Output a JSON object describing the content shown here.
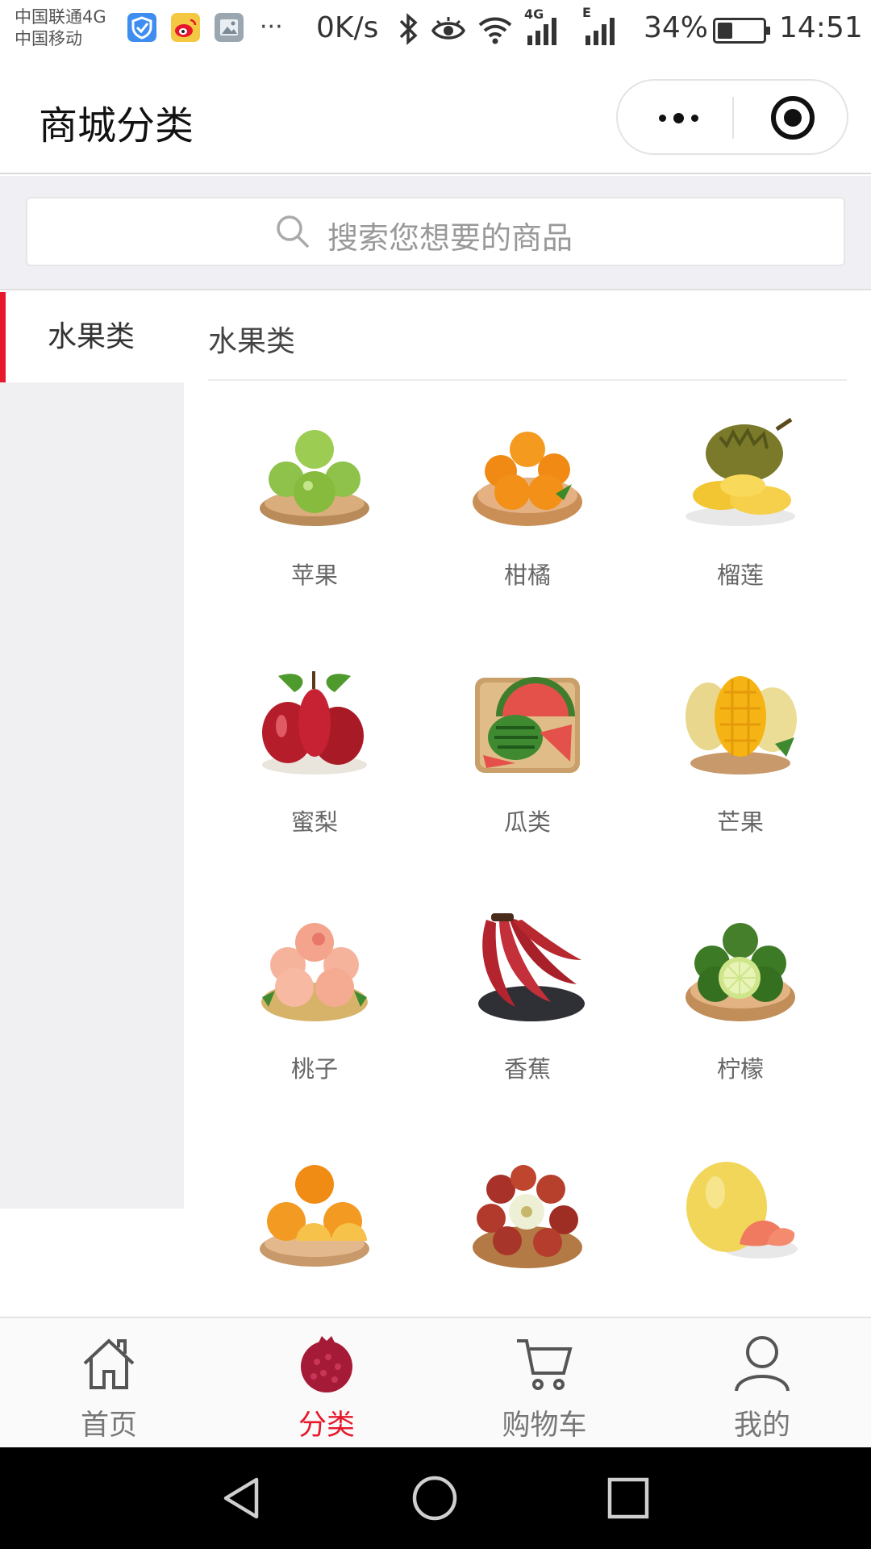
{
  "status_bar": {
    "carrier_1": "中国联通4G",
    "carrier_2": "中国移动",
    "more": "···",
    "speed": "0K/s",
    "network_4g": "4G",
    "network_e": "E",
    "battery": "34%",
    "time": "14:51",
    "icons": [
      "shield-app-icon",
      "weibo-icon",
      "gallery-icon",
      "bluetooth-icon",
      "eye-icon",
      "wifi-icon",
      "signal-icon",
      "signal-icon",
      "battery-icon"
    ]
  },
  "title_bar": {
    "title": "商城分类",
    "icons": [
      "more-icon",
      "close-target-icon"
    ]
  },
  "search": {
    "placeholder": "搜索您想要的商品",
    "icon": "search-icon"
  },
  "sidebar": {
    "items": [
      {
        "label": "水果类",
        "active": true
      }
    ]
  },
  "content": {
    "section_title": "水果类",
    "products": [
      {
        "name": "苹果",
        "icon": "apple-image"
      },
      {
        "name": "柑橘",
        "icon": "citrus-image"
      },
      {
        "name": "榴莲",
        "icon": "durian-image"
      },
      {
        "name": "蜜梨",
        "icon": "pear-image"
      },
      {
        "name": "瓜类",
        "icon": "melon-image"
      },
      {
        "name": "芒果",
        "icon": "mango-image"
      },
      {
        "name": "桃子",
        "icon": "peach-image"
      },
      {
        "name": "香蕉",
        "icon": "banana-image"
      },
      {
        "name": "柠檬",
        "icon": "lime-image"
      },
      {
        "name": "",
        "icon": "orange-image"
      },
      {
        "name": "",
        "icon": "jujube-image"
      },
      {
        "name": "",
        "icon": "pomelo-image"
      }
    ]
  },
  "tab_bar": {
    "tabs": [
      {
        "label": "首页",
        "icon": "home-icon",
        "active": false
      },
      {
        "label": "分类",
        "icon": "pomegranate-icon",
        "active": true
      },
      {
        "label": "购物车",
        "icon": "cart-icon",
        "active": false
      },
      {
        "label": "我的",
        "icon": "user-icon",
        "active": false
      }
    ]
  },
  "nav_bar": {
    "icons": [
      "back-icon",
      "home-circle-icon",
      "recents-icon"
    ]
  },
  "colors": {
    "accent": "#e5192b",
    "page_bg": "#efeff4",
    "nav_bar": "#000000"
  }
}
